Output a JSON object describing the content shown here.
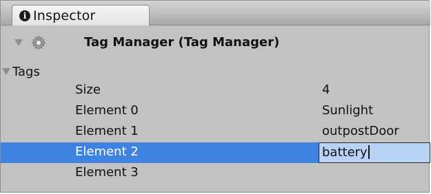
{
  "window": {
    "tab_label": "Inspector",
    "tab_icon": "info-icon"
  },
  "component": {
    "title": "Tag Manager (Tag Manager)",
    "icon": "gear-icon",
    "expanded": true
  },
  "section": {
    "label": "Tags",
    "expanded": true
  },
  "rows": [
    {
      "label": "Size",
      "value": "4"
    },
    {
      "label": "Element 0",
      "value": "Sunlight"
    },
    {
      "label": "Element 1",
      "value": "outpostDoor"
    },
    {
      "label": "Element 2",
      "value": "battery",
      "selected": true,
      "editing": true
    },
    {
      "label": "Element 3",
      "value": ""
    }
  ],
  "colors": {
    "selection": "#3f83e1",
    "edit_field": "#b8d3f6",
    "panel_background": "#c2c2c2"
  }
}
